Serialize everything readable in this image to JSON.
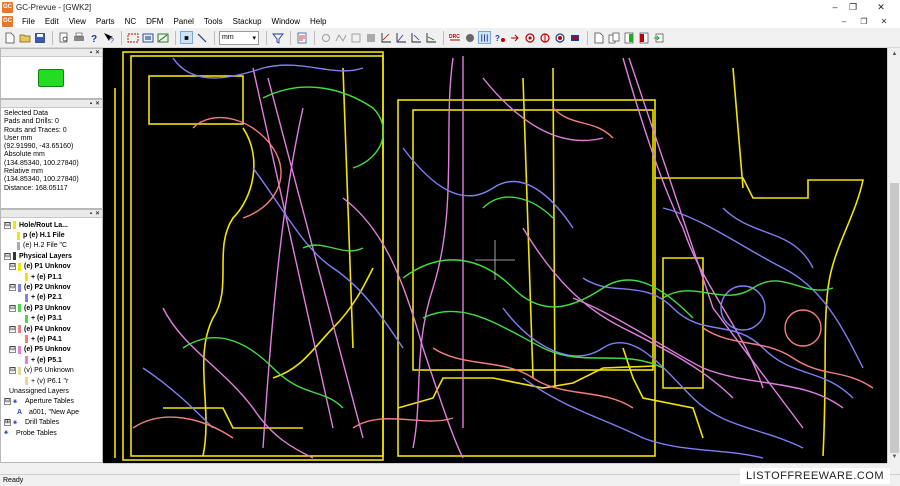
{
  "window": {
    "title": "GC-Prevue - [GWK2]",
    "app_icon_text": "GC",
    "controls": [
      "–",
      "❐",
      "✕"
    ]
  },
  "menubar": {
    "items": [
      "File",
      "Edit",
      "View",
      "Parts",
      "NC",
      "DFM",
      "Panel",
      "Tools",
      "Stackup",
      "Window",
      "Help"
    ],
    "mdi_controls": [
      "–",
      "❐",
      "✕"
    ]
  },
  "toolbar": {
    "units_value": "mm"
  },
  "info_panel": {
    "rows": [
      "Selected Data",
      "Pads and Drills: 0",
      "Routs and Traces: 0",
      "User mm",
      "(92.91990, -43.65160)",
      "Absolute mm",
      "(134.85340, 100.27840)",
      "Relative mm",
      "(134.85340, 100.27840)",
      "Distance: 168.05117"
    ]
  },
  "tree": {
    "rows": [
      {
        "exp": "⊟",
        "label": "Hole/Rout La...",
        "bold": true,
        "color": "#f2e400"
      },
      {
        "exp": "",
        "label": "p (e) H.1 File",
        "bold": true,
        "color": "#f2e400",
        "indent": 2
      },
      {
        "exp": "",
        "label": "(e) H.2 File \"C",
        "bold": false,
        "color": "#aaaaaa",
        "indent": 2
      },
      {
        "exp": "⊟",
        "label": "Physical Layers",
        "bold": true,
        "color": "#333333"
      },
      {
        "exp": "⊟",
        "label": "(e) P1 Unknov",
        "bold": true,
        "color": "#f2e400",
        "indent": 1
      },
      {
        "exp": "",
        "label": "+ (e) P1.1",
        "bold": true,
        "color": "#f2e400",
        "indent": 3
      },
      {
        "exp": "⊟",
        "label": "(e) P2 Unknov",
        "bold": true,
        "color": "#7f7ff2",
        "indent": 1
      },
      {
        "exp": "",
        "label": "+ (e) P2.1",
        "bold": true,
        "color": "#7f7ff2",
        "indent": 3
      },
      {
        "exp": "⊟",
        "label": "(e) P3 Unknov",
        "bold": true,
        "color": "#44dd44",
        "indent": 1
      },
      {
        "exp": "",
        "label": "+ (e) P3.1",
        "bold": true,
        "color": "#44dd44",
        "indent": 3
      },
      {
        "exp": "⊟",
        "label": "(e) P4 Unknov",
        "bold": true,
        "color": "#f27f7f",
        "indent": 1
      },
      {
        "exp": "",
        "label": "+ (e) P4.1",
        "bold": true,
        "color": "#f27f7f",
        "indent": 3
      },
      {
        "exp": "⊟",
        "label": "(e) P5 Unknov",
        "bold": true,
        "color": "#e07fe0",
        "indent": 1
      },
      {
        "exp": "",
        "label": "+ (e) P5.1",
        "bold": true,
        "color": "#e07fe0",
        "indent": 3
      },
      {
        "exp": "⊟",
        "label": "(v) P6 Unknown",
        "bold": false,
        "color": "#e8d890",
        "indent": 1
      },
      {
        "exp": "",
        "label": "+ (v) P6.1 \"r",
        "bold": false,
        "color": "#e8d890",
        "indent": 3
      },
      {
        "exp": "",
        "label": "Unassigned Layers",
        "bold": false,
        "color": "",
        "indent": 1
      },
      {
        "exp": "⊟",
        "label": "Aperture Tables",
        "bold": false,
        "color": "",
        "icon": "⚹"
      },
      {
        "exp": "",
        "label": "a001, \"New Ape",
        "bold": false,
        "color": "",
        "indent": 2,
        "icon": "A"
      },
      {
        "exp": "⊞",
        "label": "Drill Tables",
        "bold": false,
        "color": "",
        "icon": "⚹"
      },
      {
        "exp": "",
        "label": "Probe Tables",
        "bold": false,
        "color": "",
        "indent": 0,
        "icon": "⚹"
      }
    ]
  },
  "status": {
    "text": "Ready"
  },
  "watermark": {
    "text": "LISTOFFREEWARE.COM"
  },
  "colors": {
    "canvas_bg": "#000000",
    "layer_yellow": "#f2e400",
    "layer_purple": "#7f7ff2",
    "layer_green": "#44dd44",
    "layer_red": "#f27f7f",
    "layer_pink": "#e07fe0",
    "preview_green": "#22dd22"
  }
}
